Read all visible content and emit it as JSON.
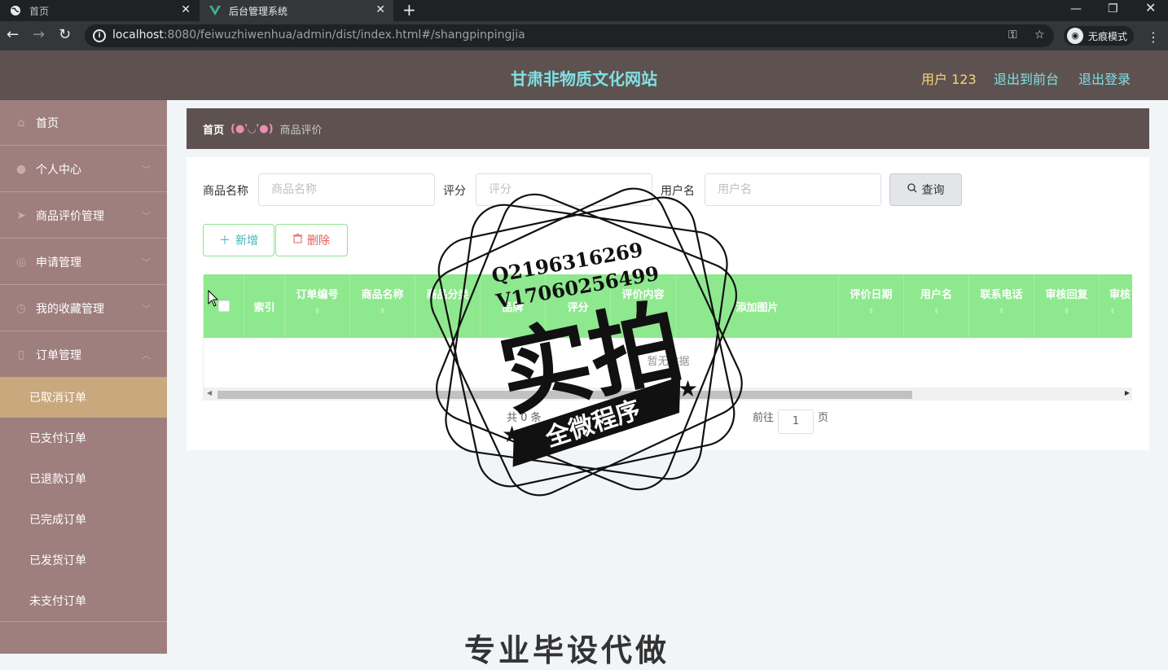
{
  "browser": {
    "tabs": [
      {
        "title": "首页",
        "icon": "globe-icon"
      },
      {
        "title": "后台管理系统",
        "icon": "vue-logo-icon"
      }
    ],
    "url_host": "localhost",
    "url_rest": ":8080/feiwuzhiwenhua/admin/dist/index.html#/shangpinpingjia",
    "incognito_label": "无痕模式"
  },
  "header": {
    "title": "甘肃非物质文化网站",
    "user": "用户 123",
    "to_front": "退出到前台",
    "logout": "退出登录"
  },
  "sidebar": {
    "items": [
      {
        "label": "首页",
        "icon": "home-icon"
      },
      {
        "label": "个人中心",
        "icon": "user-icon"
      },
      {
        "label": "商品评价管理",
        "icon": "send-icon"
      },
      {
        "label": "申请管理",
        "icon": "compass-icon"
      },
      {
        "label": "我的收藏管理",
        "icon": "clock-icon"
      },
      {
        "label": "订单管理",
        "icon": "mobile-icon"
      }
    ],
    "sub_items": [
      "已取消订单",
      "已支付订单",
      "已退款订单",
      "已完成订单",
      "已发货订单",
      "未支付订单"
    ]
  },
  "breadcrumb": {
    "home": "首页",
    "separator": "(●'◡'●)",
    "current": "商品评价"
  },
  "search": {
    "name_label": "商品名称",
    "name_placeholder": "商品名称",
    "score_label": "评分",
    "score_placeholder": "评分",
    "user_label": "用户名",
    "user_placeholder": "用户名",
    "query_label": "查询"
  },
  "actions": {
    "add": "新增",
    "delete": "删除"
  },
  "table": {
    "columns": [
      "索引",
      "订单编号",
      "商品名称",
      "商品分类",
      "品牌",
      "评分",
      "评价内容",
      "添加图片",
      "评价日期",
      "用户名",
      "联系电话",
      "审核回复",
      "审核"
    ],
    "empty_text": "暂无数据"
  },
  "pager": {
    "total": "共 0 条",
    "goto": "前往",
    "page": "1",
    "page_suffix": "页"
  },
  "watermark": {
    "qq": "Q2196316269",
    "wechat": "V17060256499",
    "main": "实拍",
    "banner": "全微程序",
    "bottom": "专业毕设代做"
  },
  "colors": {
    "header_bg": "#5e5250",
    "sidebar_bg": "#9f7e7e",
    "active_sub": "#c9a87e",
    "table_head": "#8ee88e",
    "title_accent": "#7fe0e4"
  }
}
